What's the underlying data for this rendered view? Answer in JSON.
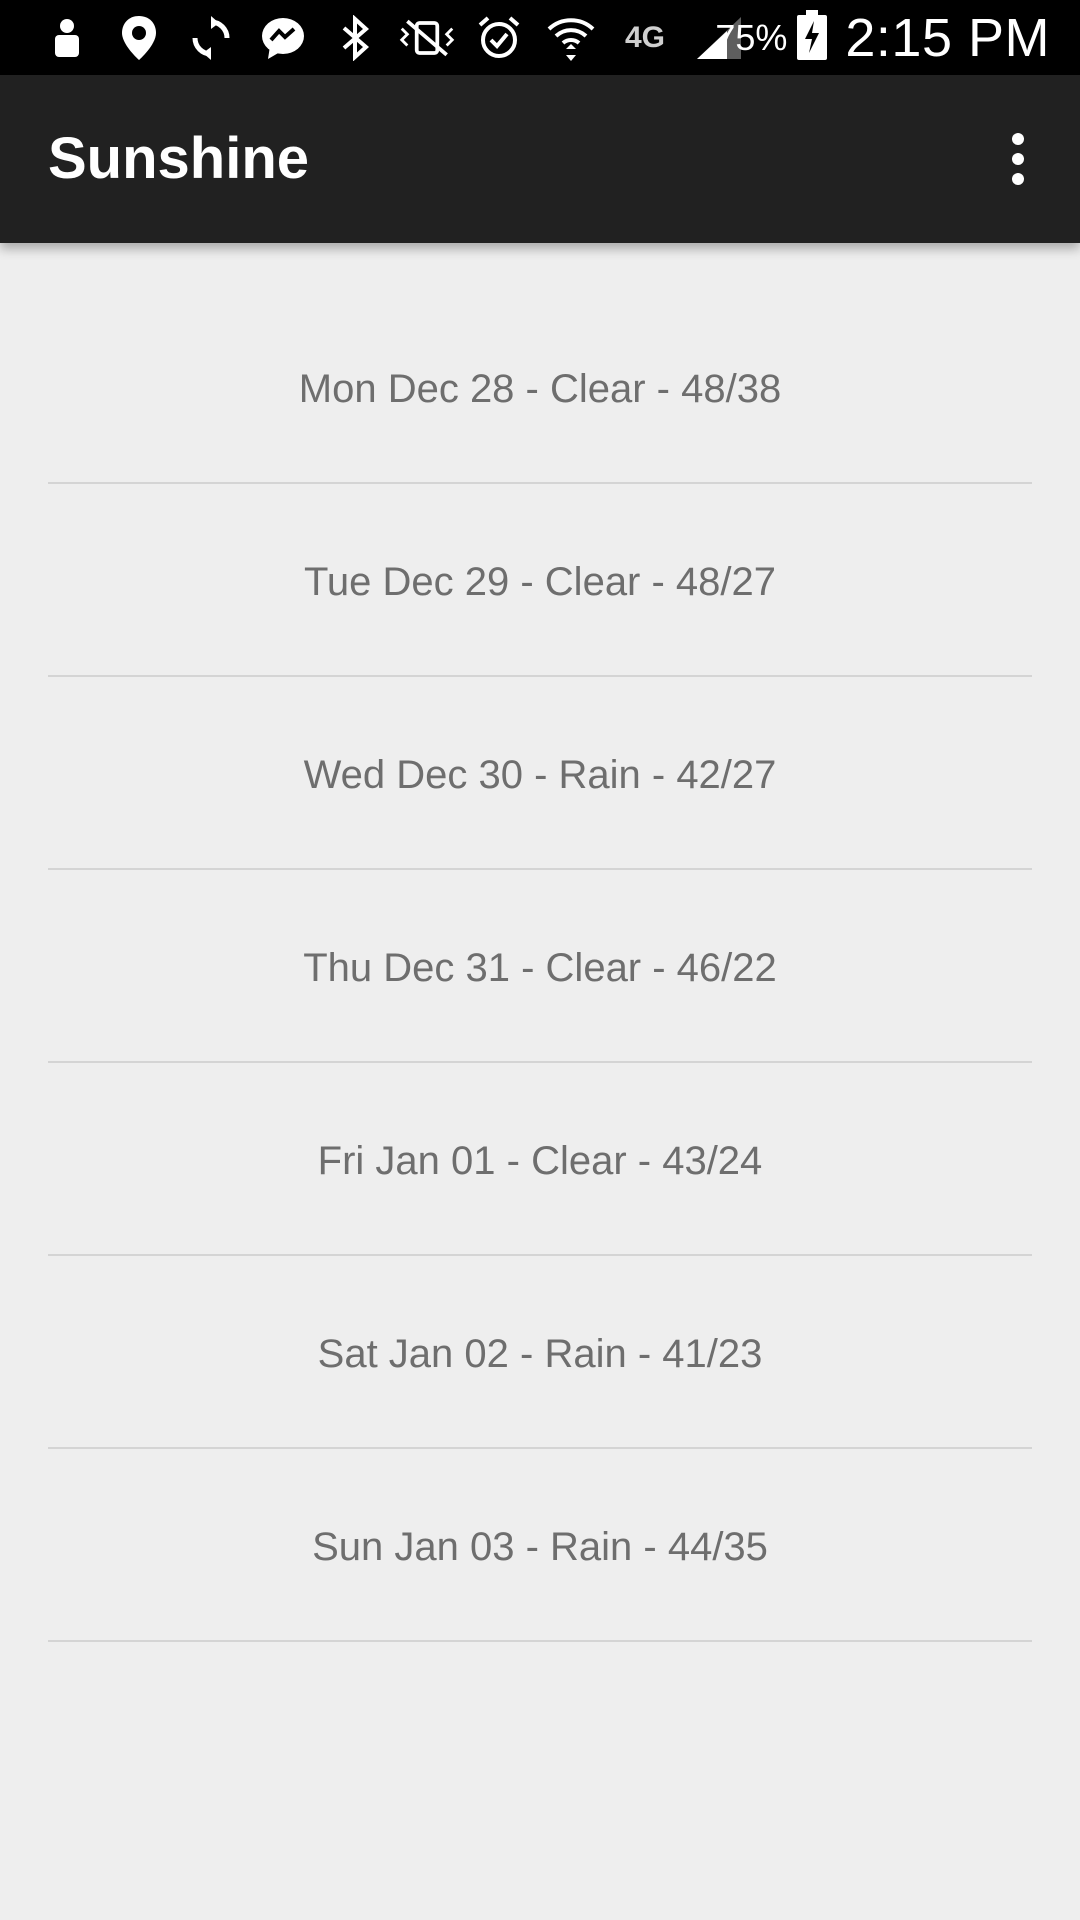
{
  "status_bar": {
    "icons": [
      "person-icon",
      "location-icon",
      "sync-icon",
      "messenger-icon",
      "bluetooth-icon",
      "vibrate-icon",
      "alarm-icon",
      "wifi-icon",
      "4g-lte-icon",
      "signal-icon"
    ],
    "network_label": "4G",
    "battery_percent": "75%",
    "time": "2:15 PM"
  },
  "app_bar": {
    "title": "Sunshine",
    "overflow_icon": "more-vert-icon"
  },
  "forecast": {
    "items": [
      "Mon Dec 28 - Clear - 48/38",
      "Tue Dec 29 - Clear - 48/27",
      "Wed Dec 30 - Rain - 42/27",
      "Thu Dec 31 - Clear - 46/22",
      "Fri Jan 01 - Clear - 43/24",
      "Sat Jan 02 - Rain - 41/23",
      "Sun Jan 03 - Rain - 44/35"
    ]
  },
  "colors": {
    "status_bar_bg": "#000000",
    "app_bar_bg": "#212121",
    "background": "#eeeeee",
    "list_text": "#6e6e6e",
    "divider": "#d4d4d4"
  }
}
